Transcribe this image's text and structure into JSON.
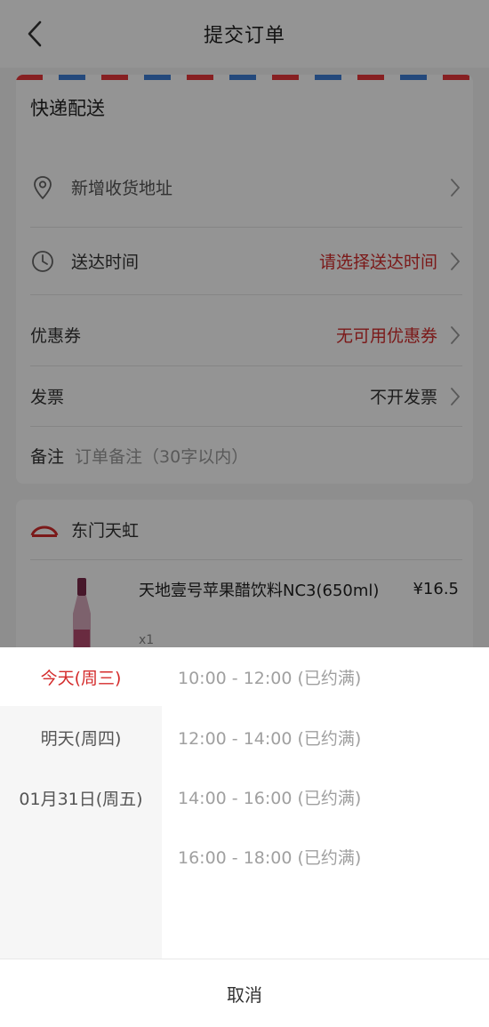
{
  "header": {
    "title": "提交订单"
  },
  "delivery": {
    "heading": "快递配送",
    "address_label": "新增收货地址",
    "time_label": "送达时间",
    "time_value": "请选择送达时间"
  },
  "coupon": {
    "label": "优惠券",
    "value": "无可用优惠券"
  },
  "invoice": {
    "label": "发票",
    "value": "不开发票"
  },
  "remark": {
    "label": "备注",
    "placeholder": "订单备注（30字以内）"
  },
  "store": {
    "name": "东门天虹",
    "product": {
      "name": "天地壹号苹果醋饮料NC3(650ml)",
      "price": "¥16.5",
      "qty": "x1"
    }
  },
  "picker": {
    "dates": [
      "今天(周三)",
      "明天(周四)",
      "01月31日(周五)"
    ],
    "slots": [
      "10:00 - 12:00 (已约满)",
      "12:00 - 14:00 (已约满)",
      "14:00 - 16:00 (已约满)",
      "16:00 - 18:00 (已约满)"
    ],
    "cancel": "取消"
  },
  "colors": {
    "accent": "#d42b2b",
    "airmail_red": "#e8373b",
    "airmail_blue": "#3f7fd6"
  }
}
